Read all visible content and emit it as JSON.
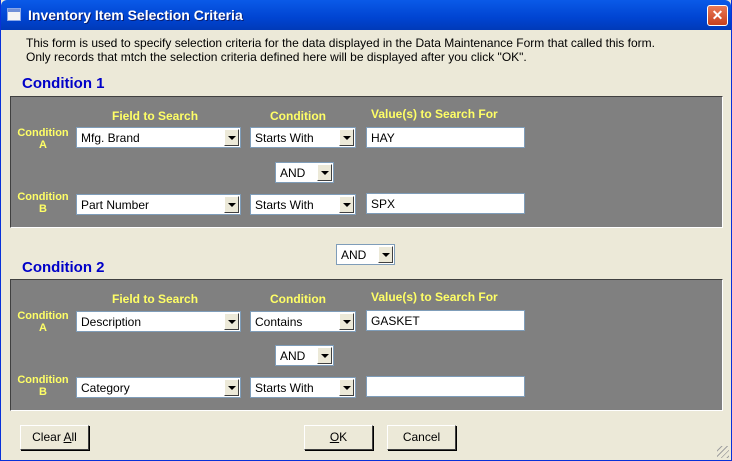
{
  "window": {
    "title": "Inventory Item Selection Criteria",
    "close_glyph": "✕"
  },
  "description": "This form is used to specify selection criteria for the data displayed in the Data Maintenance Form that called this form.  Only records that mtch the selection criteria defined here will be displayed after you click \"OK\".",
  "headers": {
    "field": "Field to Search",
    "condition": "Condition",
    "values": "Value(s) to Search For"
  },
  "condition1": {
    "title": "Condition 1",
    "a": {
      "label_line1": "Condition",
      "label_line2": "A",
      "field": "Mfg. Brand",
      "condition": "Starts With",
      "value": "HAY"
    },
    "joiner": "AND",
    "b": {
      "label_line1": "Condition",
      "label_line2": "B",
      "field": "Part Number",
      "condition": "Starts With",
      "value": "SPX"
    }
  },
  "group_joiner": "AND",
  "condition2": {
    "title": "Condition 2",
    "a": {
      "label_line1": "Condition",
      "label_line2": "A",
      "field": "Description",
      "condition": "Contains",
      "value": "GASKET"
    },
    "joiner": "AND",
    "b": {
      "label_line1": "Condition",
      "label_line2": "B",
      "field": "Category",
      "condition": "Starts With",
      "value": ""
    }
  },
  "buttons": {
    "clear_all_pre": "Clear ",
    "clear_all_u": "A",
    "clear_all_post": "ll",
    "ok_pre": "",
    "ok_u": "O",
    "ok_post": "K",
    "cancel": "Cancel"
  }
}
